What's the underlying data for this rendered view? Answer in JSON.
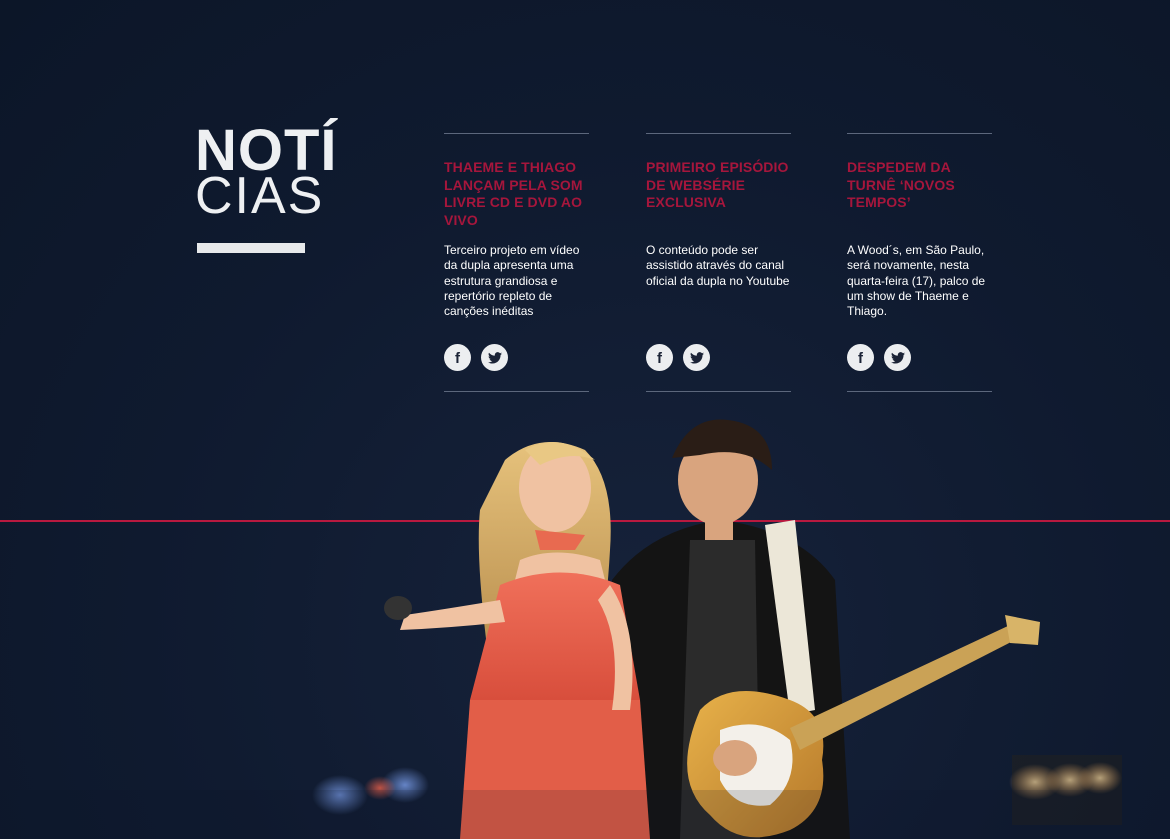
{
  "section": {
    "title_line1": "NOTÍ",
    "title_line2": "CIAS"
  },
  "news": [
    {
      "title": "THAEME E THIAGO LANÇAM PELA SOM LIVRE CD E DVD AO VIVO",
      "text": "Terceiro projeto em vídeo da dupla apresenta uma estrutura grandiosa e repertório repleto de canções inéditas"
    },
    {
      "title": "PRIMEIRO EPISÓDIO DE WEBSÉRIE EXCLUSIVA",
      "text": "O conteúdo pode ser assistido através do canal oficial da dupla no Youtube"
    },
    {
      "title": "DESPEDEM DA TURNÊ ‘NOVOS TEMPOS’",
      "text": "A Wood´s, em São Paulo, será novamente, nesta quarta-feira (17), palco de um show de Thaeme e Thiago."
    }
  ],
  "share_icons": {
    "facebook": "facebook-icon",
    "twitter": "twitter-icon"
  },
  "colors": {
    "background": "#0f1a2f",
    "accent": "#a6163c",
    "accent_line": "#b8193f",
    "heading": "#eef0f2",
    "body_text": "#ffffff"
  },
  "image": {
    "subject": "concert-photo-duo-performing"
  }
}
